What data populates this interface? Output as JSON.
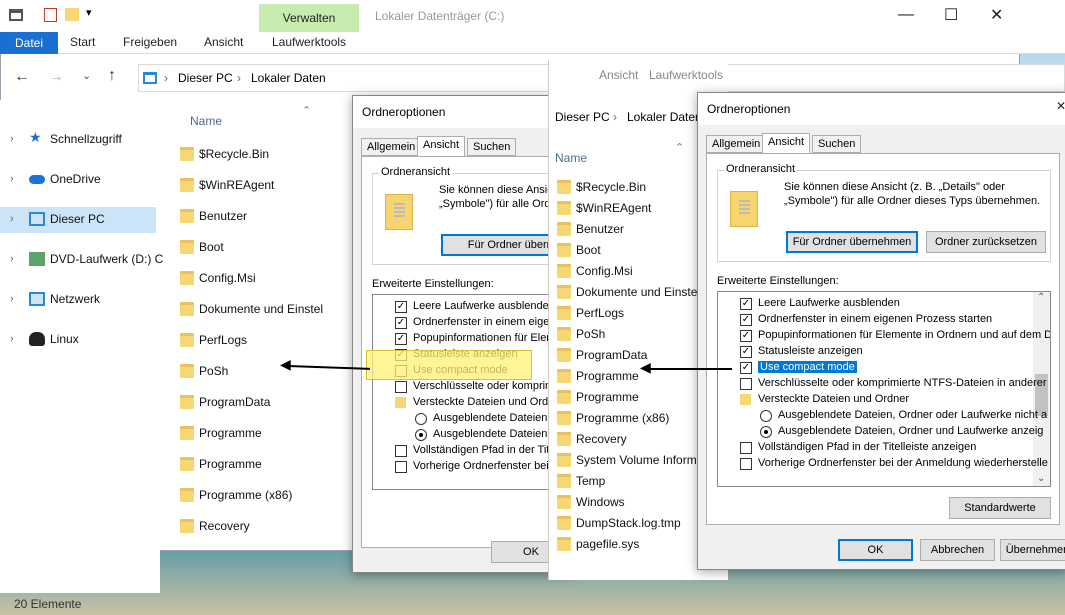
{
  "explorer": {
    "manage_tab": "Verwalten",
    "window_title": "Lokaler Datenträger (C:)",
    "ribbon_tabs": [
      "Datei",
      "Start",
      "Freigeben",
      "Ansicht",
      "Laufwerktools"
    ],
    "breadcrumb": [
      "Dieser PC",
      "Lokaler Daten"
    ],
    "column_name": "Name",
    "nav": [
      "Schnellzugriff",
      "OneDrive",
      "Dieser PC",
      "DVD-Laufwerk (D:) C",
      "Netzwerk",
      "Linux"
    ],
    "files": [
      "$Recycle.Bin",
      "$WinREAgent",
      "Benutzer",
      "Boot",
      "Config.Msi",
      "Dokumente und Einstel",
      "PerfLogs",
      "PoSh",
      "ProgramData",
      "Programme",
      "Programme",
      "Programme (x86)",
      "Recovery"
    ],
    "status": "20 Elemente"
  },
  "explorer2": {
    "ribbon_tabs": [
      "Ansicht",
      "Laufwerktools"
    ],
    "breadcrumb": [
      "Dieser PC",
      "Lokaler Daten"
    ],
    "column_name": "Name",
    "files": [
      "$Recycle.Bin",
      "$WinREAgent",
      "Benutzer",
      "Boot",
      "Config.Msi",
      "Dokumente und Einstel",
      "PerfLogs",
      "PoSh",
      "ProgramData",
      "Programme",
      "Programme",
      "Programme (x86)",
      "Recovery",
      "System Volume Informa",
      "Temp",
      "Windows",
      "DumpStack.log.tmp",
      "pagefile.sys"
    ]
  },
  "dialog1": {
    "title": "Ordneroptionen",
    "tabs": [
      "Allgemein",
      "Ansicht",
      "Suchen"
    ],
    "group_title": "Ordneransicht",
    "group_text_1": "Sie können diese Ansic",
    "group_text_2": "„Symbole\") für alle Ordr",
    "apply_button": "Für Ordner übernehm",
    "advanced_label": "Erweiterte Einstellungen:",
    "rows": [
      {
        "type": "check",
        "checked": true,
        "label": "Leere Laufwerke ausblenden"
      },
      {
        "type": "check",
        "checked": true,
        "label": "Ordnerfenster in einem eigen"
      },
      {
        "type": "check",
        "checked": true,
        "label": "Popupinformationen für Elem"
      },
      {
        "type": "check",
        "checked": true,
        "label": "Statusleiste anzeigen"
      },
      {
        "type": "check",
        "checked": false,
        "label": "Use compact mode"
      },
      {
        "type": "check",
        "checked": false,
        "label": "Verschlüsselte oder komprimi"
      },
      {
        "type": "folder",
        "label": "Versteckte Dateien und Ordr"
      },
      {
        "type": "radio",
        "checked": false,
        "label": "Ausgeblendete Dateien,"
      },
      {
        "type": "radio",
        "checked": true,
        "label": "Ausgeblendete Dateien,"
      },
      {
        "type": "check",
        "checked": false,
        "label": "Vollständigen Pfad in der Titele"
      },
      {
        "type": "check",
        "checked": false,
        "label": "Vorherige Ordnerfenster bei d"
      }
    ],
    "ok": "OK"
  },
  "dialog2": {
    "title": "Ordneroptionen",
    "tabs": [
      "Allgemein",
      "Ansicht",
      "Suchen"
    ],
    "group_title": "Ordneransicht",
    "group_text_1": "Sie können diese Ansicht (z. B. „Details\" oder",
    "group_text_2": "„Symbole\") für alle Ordner dieses Typs übernehmen.",
    "apply_button": "Für Ordner übernehmen",
    "reset_button": "Ordner zurücksetzen",
    "advanced_label": "Erweiterte Einstellungen:",
    "rows": [
      {
        "type": "check",
        "checked": true,
        "label": "Leere Laufwerke ausblenden"
      },
      {
        "type": "check",
        "checked": true,
        "label": "Ordnerfenster in einem eigenen Prozess starten"
      },
      {
        "type": "check",
        "checked": true,
        "label": "Popupinformationen für Elemente in Ordnern und auf dem D"
      },
      {
        "type": "check",
        "checked": true,
        "label": "Statusleiste anzeigen"
      },
      {
        "type": "check",
        "checked": true,
        "label": "Use compact mode",
        "selected": true
      },
      {
        "type": "check",
        "checked": false,
        "label": "Verschlüsselte oder komprimierte NTFS-Dateien in anderer"
      },
      {
        "type": "folder",
        "label": "Versteckte Dateien und Ordner"
      },
      {
        "type": "radio",
        "checked": false,
        "label": "Ausgeblendete Dateien, Ordner oder Laufwerke nicht a"
      },
      {
        "type": "radio",
        "checked": true,
        "label": "Ausgeblendete Dateien, Ordner und Laufwerke anzeig"
      },
      {
        "type": "check",
        "checked": false,
        "label": "Vollständigen Pfad in der Titelleiste anzeigen"
      },
      {
        "type": "check",
        "checked": false,
        "label": "Vorherige Ordnerfenster bei der Anmeldung wiederherstelle"
      }
    ],
    "defaults_button": "Standardwerte",
    "ok": "OK",
    "cancel": "Abbrechen",
    "apply": "Übernehmen"
  },
  "colors": {
    "highlight": "#fff176",
    "selection": "#0078d7",
    "ribbon_file": "#1a6fd0"
  }
}
